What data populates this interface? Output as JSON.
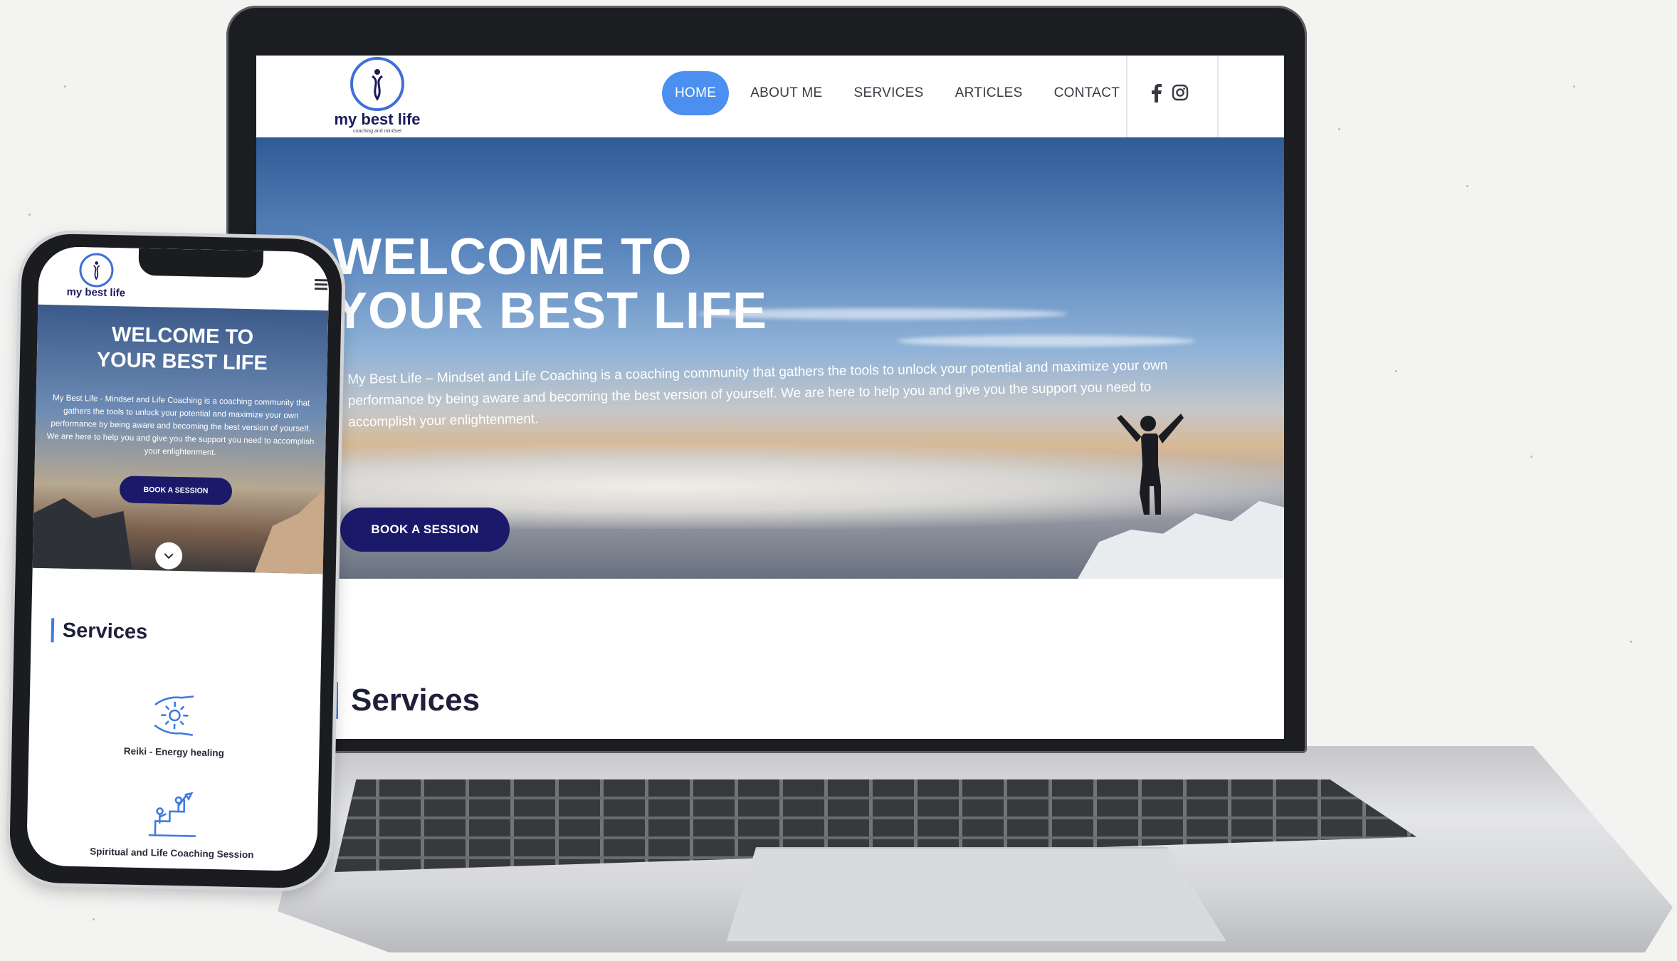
{
  "brand": {
    "name": "my best life",
    "tagline": "coaching and mindset",
    "primary_color": "#1b1a6a",
    "accent_color": "#4b8ff0"
  },
  "nav": {
    "items": [
      {
        "label": "HOME",
        "active": true
      },
      {
        "label": "ABOUT ME",
        "active": false
      },
      {
        "label": "SERVICES",
        "active": false
      },
      {
        "label": "ARTICLES",
        "active": false
      },
      {
        "label": "CONTACT",
        "active": false
      }
    ],
    "social_icons": [
      "facebook-icon",
      "instagram-icon"
    ]
  },
  "hero": {
    "title_line1": "WELCOME TO",
    "title_line2": "YOUR BEST LIFE",
    "text": "My Best Life – Mindset and Life Coaching is a coaching community that gathers the tools to unlock your potential and maximize your own performance by being aware and becoming the best version of yourself. We are here to help you and give you the support you need to accomplish your enlightenment.",
    "button_label": "BOOK A SESSION",
    "scroll_icon": "chevron-down-icon"
  },
  "services": {
    "title": "Services"
  },
  "mobile": {
    "title_line1": "WELCOME TO",
    "title_line2": "YOUR BEST LIFE",
    "text": "My Best Life - Mindset and Life Coaching is a coaching community that gathers the tools to unlock your potential and maximize your own performance by being aware and becoming the best version of yourself. We are here to help you and give you the support you need to accomplish your enlightenment.",
    "button_label": "BOOK A SESSION",
    "services_title": "Services",
    "service_items": [
      {
        "label": "Reiki - Energy healing",
        "icon": "healing-hands-icon"
      },
      {
        "label": "Spiritual and Life Coaching Session",
        "icon": "coaching-climb-icon"
      }
    ]
  }
}
